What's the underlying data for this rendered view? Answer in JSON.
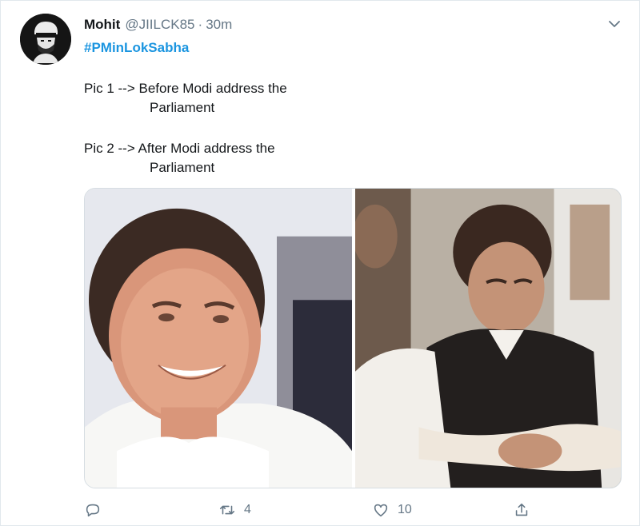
{
  "tweet": {
    "author_name": "Mohit",
    "handle": "@JIILCK85",
    "separator": "·",
    "time": "30m",
    "hashtag": "#PMinLokSabha",
    "lines": [
      "Pic 1 --> Before Modi address the",
      "Parliament",
      "Pic 2 --> After Modi address the",
      "Parliament"
    ]
  },
  "actions": {
    "reply_count": "",
    "retweet_count": "4",
    "like_count": "10"
  },
  "icons": {
    "avatar": "user-avatar",
    "caret": "chevron-down-icon",
    "reply": "reply-icon",
    "retweet": "retweet-icon",
    "like": "heart-icon",
    "share": "share-icon"
  },
  "colors": {
    "hashtag": "#1b95e0",
    "muted": "#657786",
    "text": "#14171a",
    "border": "#e1e8ed"
  }
}
